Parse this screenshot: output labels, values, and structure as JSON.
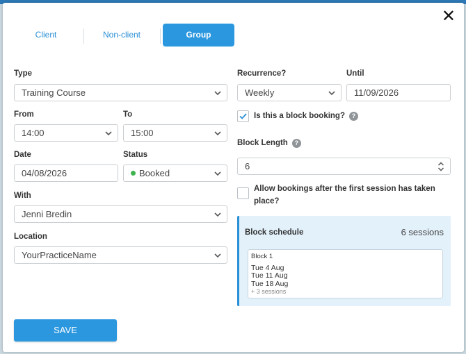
{
  "close_label": "✕",
  "tabs": [
    {
      "label": "Client"
    },
    {
      "label": "Non-client"
    },
    {
      "label": "Group"
    }
  ],
  "form": {
    "type": {
      "label": "Type",
      "value": "Training Course"
    },
    "from": {
      "label": "From",
      "value": "14:00"
    },
    "to": {
      "label": "To",
      "value": "15:00"
    },
    "date": {
      "label": "Date",
      "value": "04/08/2026"
    },
    "status": {
      "label": "Status",
      "value": "Booked"
    },
    "with": {
      "label": "With",
      "value": "Jenni Bredin"
    },
    "location": {
      "label": "Location",
      "value": "YourPracticeName"
    },
    "recurrence": {
      "label": "Recurrence?",
      "value": "Weekly"
    },
    "until": {
      "label": "Until",
      "value": "11/09/2026"
    },
    "block_booking": {
      "label": "Is this a block booking?",
      "checked": true,
      "help": "?"
    },
    "block_length": {
      "label": "Block Length",
      "value": "6",
      "help": "?"
    },
    "allow_bookings": {
      "label_line1": "Allow bookings after the first session has taken",
      "label_line2": "place?",
      "checked": false
    }
  },
  "schedule": {
    "title": "Block schedule",
    "count": "6 sessions",
    "block_label": "Block 1",
    "sessions": [
      "Tue 4 Aug",
      "Tue 11 Aug",
      "Tue 18 Aug"
    ],
    "more": "+ 3 sessions"
  },
  "save_label": "SAVE",
  "colors": {
    "accent": "#2a97df",
    "status_booked": "#3fb34f",
    "schedule_bg": "#e3f1fb"
  }
}
